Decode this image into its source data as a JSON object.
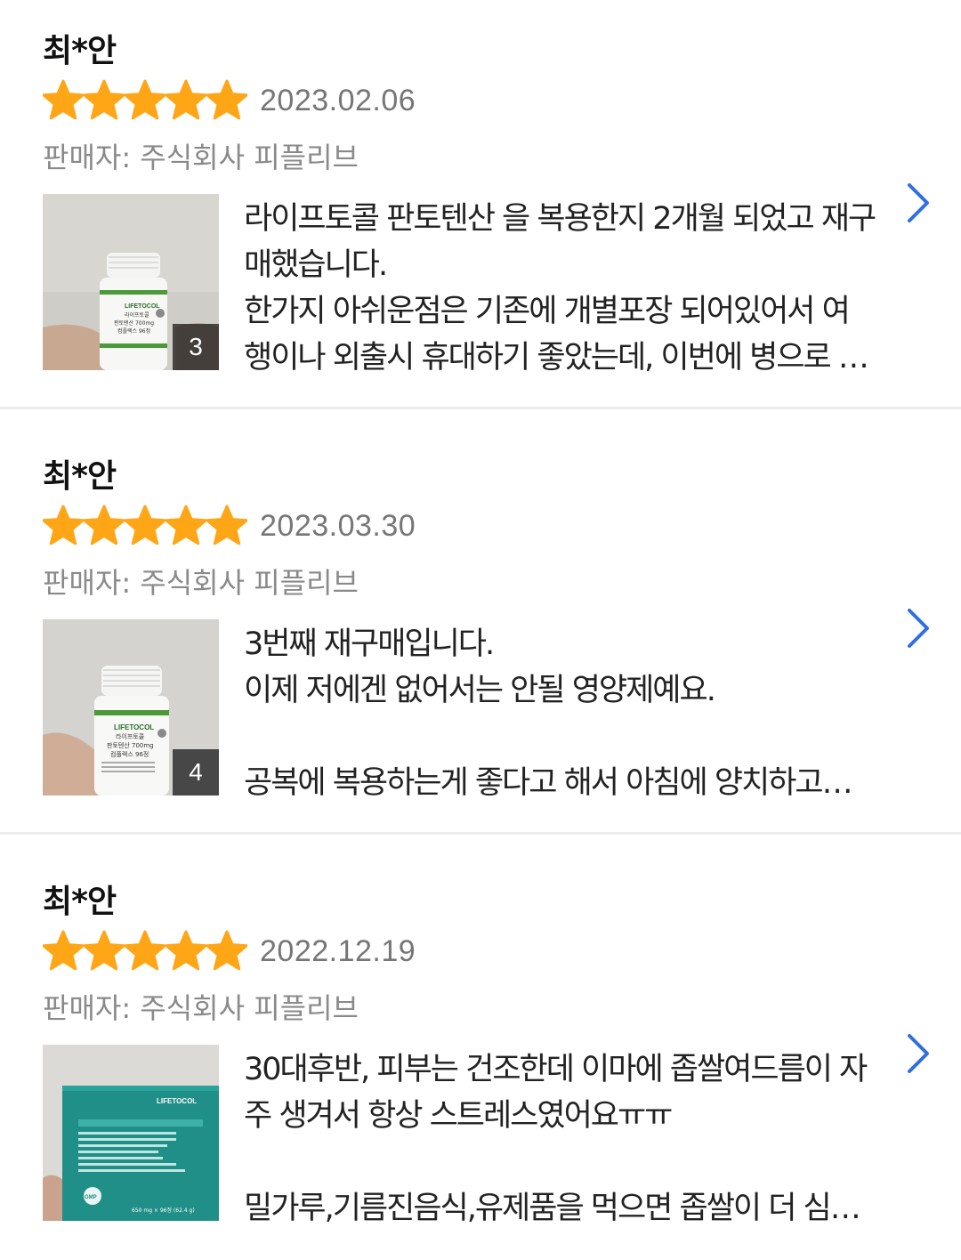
{
  "colors": {
    "star": "#ffa617",
    "chevron": "#2f6fe0",
    "date": "#767676",
    "seller": "#8a8a8a",
    "divider": "#ececec"
  },
  "reviews": [
    {
      "reviewer": "최*안",
      "rating": 5,
      "date": "2023.02.06",
      "seller": "판매자: 주식회사 피플리브",
      "photo_count": "3",
      "text": "라이프토콜 판토텐산 을 복용한지 2개월 되었고 재구매했습니다.\n한가지 아쉬운점은 기존에 개별포장 되어있어서 여행이나 외출시 휴대하기 좋았는데, 이번에 병으로 바뀌…",
      "thumb_icon": "product-bottle-photo",
      "chevron_icon": "chevron-right-icon"
    },
    {
      "reviewer": "최*안",
      "rating": 5,
      "date": "2023.03.30",
      "seller": "판매자: 주식회사 피플리브",
      "photo_count": "4",
      "text": "3번째 재구매입니다.\n이제 저에겐 없어서는 안될 영양제예요.\n\n공복에 복용하는게 좋다고 해서 아침에 양치하고 바…",
      "thumb_icon": "product-bottle-photo",
      "chevron_icon": "chevron-right-icon"
    },
    {
      "reviewer": "최*안",
      "rating": 5,
      "date": "2022.12.19",
      "seller": "판매자: 주식회사 피플리브",
      "photo_count": "",
      "text": "30대후반, 피부는 건조한데 이마에 좁쌀여드름이 자주 생겨서 항상 스트레스였어요ㅠㅠ\n\n밀가루,기름진음식,유제품을 먹으면 좁쌀이 더 심하…",
      "thumb_icon": "product-box-photo",
      "chevron_icon": "chevron-right-icon"
    }
  ],
  "product_labels": {
    "brand": "LIFETOCOL",
    "bottle_name": "라이프토콜",
    "bottle_desc": "판토텐산 700mg",
    "bottle_count": "컴플렉스 96정",
    "box_count": "650 mg × 96정 (62.4 g)",
    "gmp": "GMP"
  }
}
